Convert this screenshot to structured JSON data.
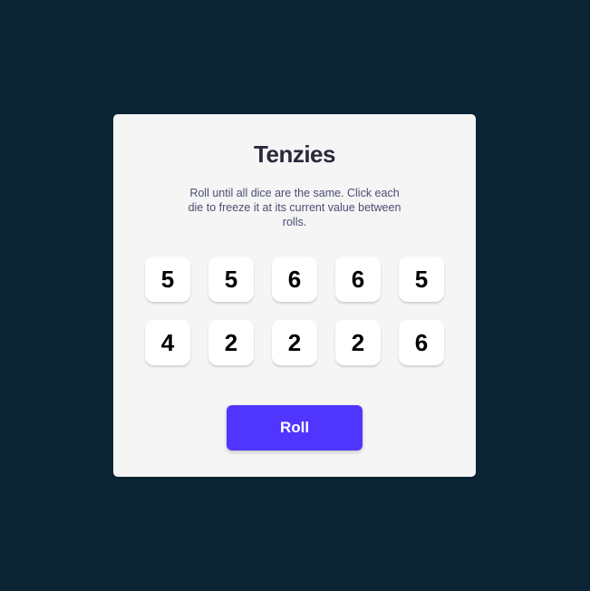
{
  "app": {
    "title": "Tenzies",
    "instructions": "Roll until all dice are the same. Click each die to freeze it at its current value between rolls."
  },
  "dice": [
    {
      "value": "5",
      "held": false
    },
    {
      "value": "5",
      "held": false
    },
    {
      "value": "6",
      "held": false
    },
    {
      "value": "6",
      "held": false
    },
    {
      "value": "5",
      "held": false
    },
    {
      "value": "4",
      "held": false
    },
    {
      "value": "2",
      "held": false
    },
    {
      "value": "2",
      "held": false
    },
    {
      "value": "2",
      "held": false
    },
    {
      "value": "6",
      "held": false
    }
  ],
  "controls": {
    "roll_label": "Roll"
  },
  "colors": {
    "background": "#0B2434",
    "card": "#F5F5F5",
    "die": "#FFFFFF",
    "accent": "#5035FF"
  }
}
